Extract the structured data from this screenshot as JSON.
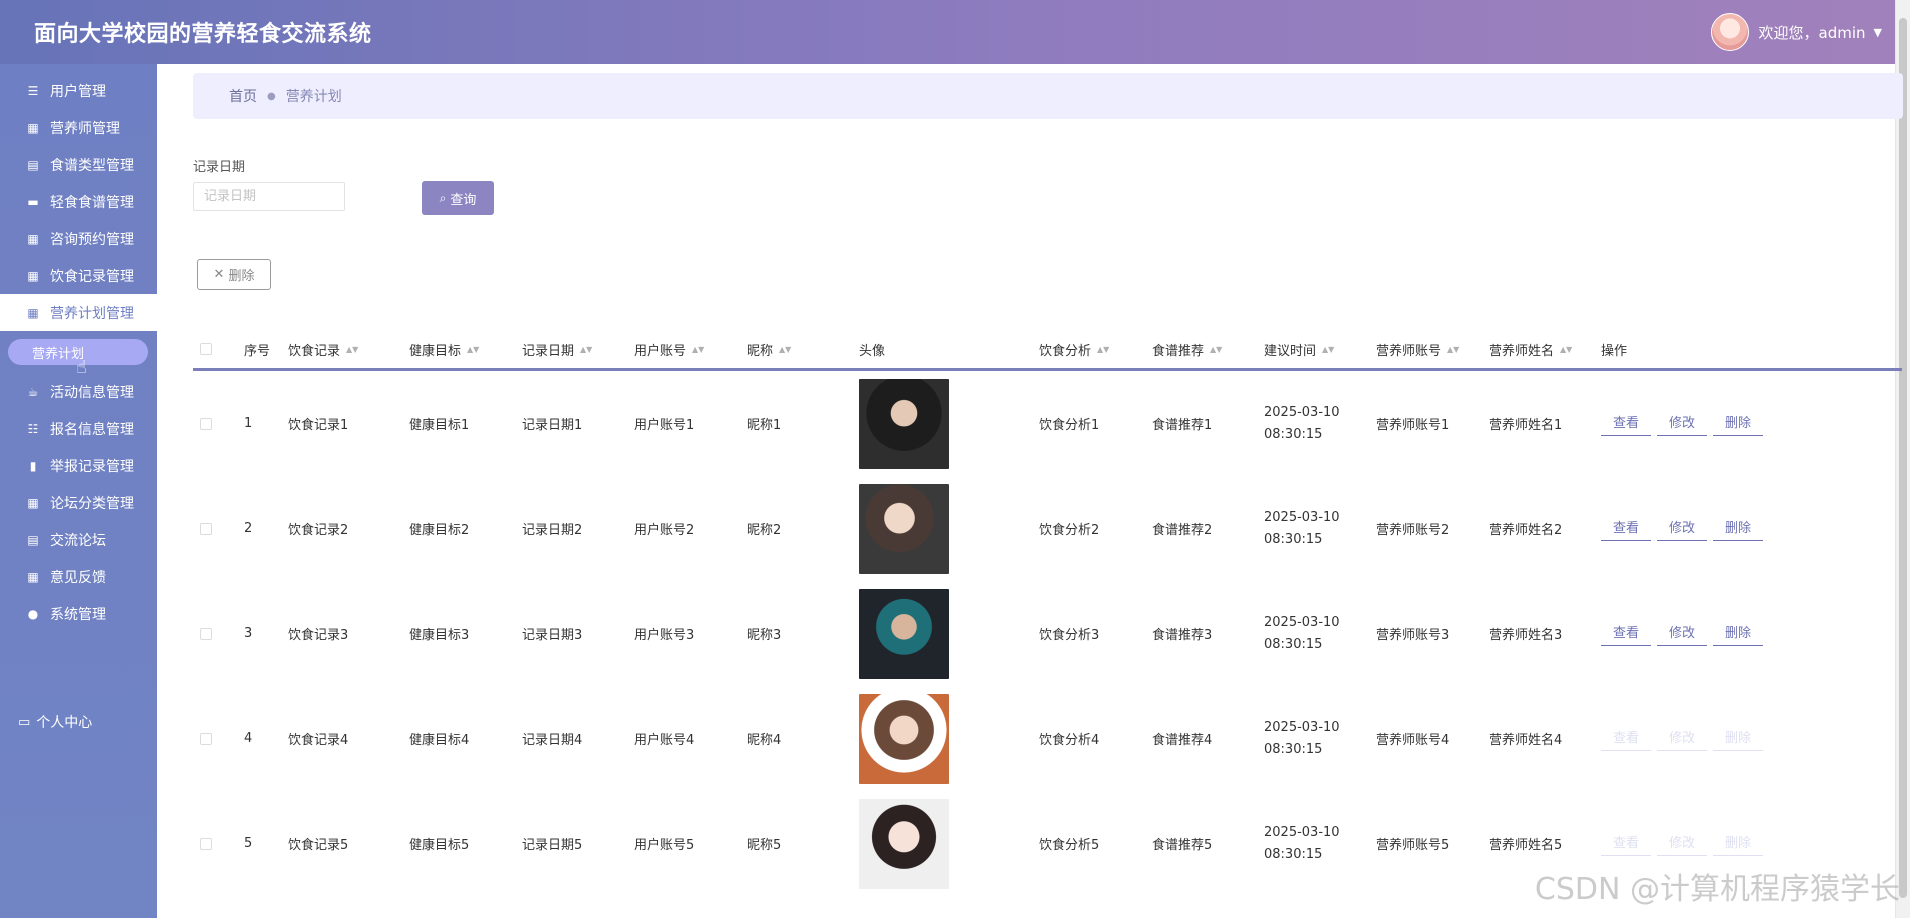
{
  "app": {
    "title": "面向大学校园的营养轻食交流系统"
  },
  "header": {
    "welcome": "欢迎您，admin"
  },
  "sidebar": {
    "items": [
      {
        "label": "用户管理",
        "icon": "list-icon"
      },
      {
        "label": "营养师管理",
        "icon": "grid-icon"
      },
      {
        "label": "食谱类型管理",
        "icon": "doc-icon"
      },
      {
        "label": "轻食食谱管理",
        "icon": "monitor-icon"
      },
      {
        "label": "咨询预约管理",
        "icon": "grid-icon"
      },
      {
        "label": "饮食记录管理",
        "icon": "grid-icon"
      },
      {
        "label": "营养计划管理",
        "icon": "grid-icon"
      },
      {
        "label": "活动信息管理",
        "icon": "cup-icon"
      },
      {
        "label": "报名信息管理",
        "icon": "sliders-icon"
      },
      {
        "label": "举报记录管理",
        "icon": "book-icon"
      },
      {
        "label": "论坛分类管理",
        "icon": "grid-icon"
      },
      {
        "label": "交流论坛",
        "icon": "doc-icon"
      },
      {
        "label": "意见反馈",
        "icon": "grid-icon"
      },
      {
        "label": "系统管理",
        "icon": "pin-icon"
      }
    ],
    "active_submenu": "营养计划",
    "personal": "个人中心"
  },
  "breadcrumb": {
    "home": "首页",
    "current": "营养计划"
  },
  "filter": {
    "label": "记录日期",
    "placeholder": "记录日期",
    "search_button": "查询"
  },
  "toolbar": {
    "delete_button": "删除"
  },
  "table": {
    "headers": {
      "index": "序号",
      "diet_record": "饮食记录",
      "health_goal": "健康目标",
      "record_date": "记录日期",
      "user_account": "用户账号",
      "nickname": "昵称",
      "avatar": "头像",
      "diet_analysis": "饮食分析",
      "recipe": "食谱推荐",
      "suggest_time": "建议时间",
      "nutritionist_account": "营养师账号",
      "nutritionist_name": "营养师姓名",
      "actions": "操作"
    },
    "action_labels": {
      "view": "查看",
      "edit": "修改",
      "delete": "删除"
    },
    "rows": [
      {
        "index": "1",
        "diet_record": "饮食记录1",
        "health_goal": "健康目标1",
        "record_date": "记录日期1",
        "user_account": "用户账号1",
        "nickname": "昵称1",
        "diet_analysis": "饮食分析1",
        "recipe": "食谱推荐1",
        "suggest_time": "2025-03-10 08:30:15",
        "nutritionist_account": "营养师账号1",
        "nutritionist_name": "营养师姓名1"
      },
      {
        "index": "2",
        "diet_record": "饮食记录2",
        "health_goal": "健康目标2",
        "record_date": "记录日期2",
        "user_account": "用户账号2",
        "nickname": "昵称2",
        "diet_analysis": "饮食分析2",
        "recipe": "食谱推荐2",
        "suggest_time": "2025-03-10 08:30:15",
        "nutritionist_account": "营养师账号2",
        "nutritionist_name": "营养师姓名2"
      },
      {
        "index": "3",
        "diet_record": "饮食记录3",
        "health_goal": "健康目标3",
        "record_date": "记录日期3",
        "user_account": "用户账号3",
        "nickname": "昵称3",
        "diet_analysis": "饮食分析3",
        "recipe": "食谱推荐3",
        "suggest_time": "2025-03-10 08:30:15",
        "nutritionist_account": "营养师账号3",
        "nutritionist_name": "营养师姓名3"
      },
      {
        "index": "4",
        "diet_record": "饮食记录4",
        "health_goal": "健康目标4",
        "record_date": "记录日期4",
        "user_account": "用户账号4",
        "nickname": "昵称4",
        "diet_analysis": "饮食分析4",
        "recipe": "食谱推荐4",
        "suggest_time": "2025-03-10 08:30:15",
        "nutritionist_account": "营养师账号4",
        "nutritionist_name": "营养师姓名4"
      },
      {
        "index": "5",
        "diet_record": "饮食记录5",
        "health_goal": "健康目标5",
        "record_date": "记录日期5",
        "user_account": "用户账号5",
        "nickname": "昵称5",
        "diet_analysis": "饮食分析5",
        "recipe": "食谱推荐5",
        "suggest_time": "2025-03-10 08:30:15",
        "nutritionist_account": "营养师账号5",
        "nutritionist_name": "营养师姓名5"
      }
    ]
  },
  "watermark": "CSDN @计算机程序猿学长",
  "colors": {
    "accent": "#6f7fc3",
    "header_gradient_end": "#a181bb",
    "search_button": "#8b85c2"
  }
}
